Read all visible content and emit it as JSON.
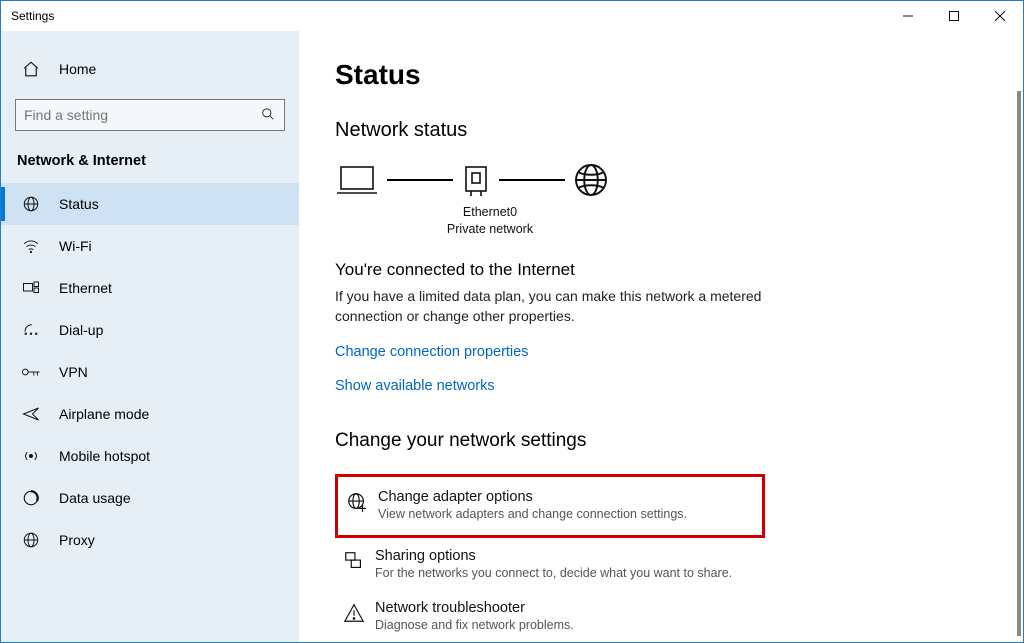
{
  "window": {
    "title": "Settings"
  },
  "sidebar": {
    "home": "Home",
    "search_placeholder": "Find a setting",
    "category": "Network & Internet",
    "items": [
      {
        "label": "Status",
        "icon": "globe-icon",
        "selected": true
      },
      {
        "label": "Wi-Fi",
        "icon": "wifi-icon",
        "selected": false
      },
      {
        "label": "Ethernet",
        "icon": "ethernet-icon",
        "selected": false
      },
      {
        "label": "Dial-up",
        "icon": "dialup-icon",
        "selected": false
      },
      {
        "label": "VPN",
        "icon": "vpn-icon",
        "selected": false
      },
      {
        "label": "Airplane mode",
        "icon": "airplane-icon",
        "selected": false
      },
      {
        "label": "Mobile hotspot",
        "icon": "hotspot-icon",
        "selected": false
      },
      {
        "label": "Data usage",
        "icon": "datausage-icon",
        "selected": false
      },
      {
        "label": "Proxy",
        "icon": "proxy-icon",
        "selected": false
      }
    ]
  },
  "main": {
    "title": "Status",
    "network_status_heading": "Network status",
    "diagram": {
      "adapter": "Ethernet0",
      "network_type": "Private network"
    },
    "connected_title": "You're connected to the Internet",
    "connected_desc": "If you have a limited data plan, you can make this network a metered connection or change other properties.",
    "link_change_props": "Change connection properties",
    "link_show_networks": "Show available networks",
    "change_settings_heading": "Change your network settings",
    "options": [
      {
        "title": "Change adapter options",
        "desc": "View network adapters and change connection settings.",
        "icon": "globe-plus-icon",
        "highlighted": true
      },
      {
        "title": "Sharing options",
        "desc": "For the networks you connect to, decide what you want to share.",
        "icon": "sharing-icon",
        "highlighted": false
      },
      {
        "title": "Network troubleshooter",
        "desc": "Diagnose and fix network problems.",
        "icon": "warning-icon",
        "highlighted": false
      }
    ]
  }
}
